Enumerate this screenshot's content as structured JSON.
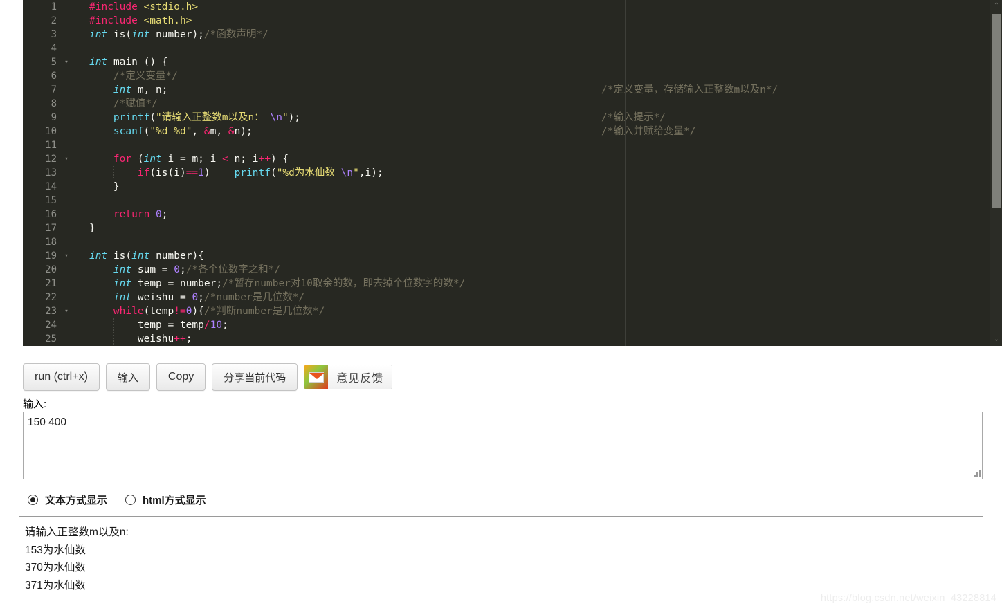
{
  "editor": {
    "lines": [
      {
        "n": "1",
        "fold": "",
        "html": "<span class='pp'>#include</span> <span class='inc'>&lt;stdio.h&gt;</span>",
        "comment": ""
      },
      {
        "n": "2",
        "fold": "",
        "html": "<span class='pp'>#include</span> <span class='inc'>&lt;math.h&gt;</span>",
        "comment": ""
      },
      {
        "n": "3",
        "fold": "",
        "html": "<span class='k'>int</span> <span class='pl'>is(</span><span class='k'>int</span> <span class='pl'>number);</span><span class='cm'>/*&#20989;&#25968;&#22768;&#26126;*/</span>",
        "comment": ""
      },
      {
        "n": "4",
        "fold": "",
        "html": "",
        "comment": ""
      },
      {
        "n": "5",
        "fold": "▾",
        "html": "<span class='k'>int</span> <span class='pl'>main () {</span>",
        "comment": ""
      },
      {
        "n": "6",
        "fold": "",
        "html": "    <span class='cm'>/*&#23450;&#20041;&#21464;&#37327;*/</span>",
        "comment": ""
      },
      {
        "n": "7",
        "fold": "",
        "html": "    <span class='k'>int</span> <span class='pl'>m, n;</span>",
        "comment": "/*定义变量，存储输入正整数m以及n*/"
      },
      {
        "n": "8",
        "fold": "",
        "html": "    <span class='cm'>/*&#36171;&#20540;*/</span>",
        "comment": ""
      },
      {
        "n": "9",
        "fold": "",
        "html": "    <span class='fn'>printf</span><span class='pl'>(</span><span class='str'>\"&#35831;&#36755;&#20837;&#27491;&#25972;&#25968;m&#20197;&#21450;n&#65306; </span><span class='esc'>\\n</span><span class='str'>\"</span><span class='pl'>);</span>",
        "comment": "/*输入提示*/"
      },
      {
        "n": "10",
        "fold": "",
        "html": "    <span class='fn'>scanf</span><span class='pl'>(</span><span class='str'>\"%d %d\"</span><span class='pl'>, </span><span class='op'>&amp;</span><span class='pl'>m, </span><span class='op'>&amp;</span><span class='pl'>n);</span>",
        "comment": "/*输入并赋给变量*/"
      },
      {
        "n": "11",
        "fold": "",
        "html": "",
        "comment": ""
      },
      {
        "n": "12",
        "fold": "▾",
        "html": "    <span class='kw'>for</span> <span class='pl'>(</span><span class='k'>int</span> <span class='pl'>i = m; i </span><span class='op'>&lt;</span><span class='pl'> n; i</span><span class='op'>++</span><span class='pl'>) {</span>",
        "comment": ""
      },
      {
        "n": "13",
        "fold": "",
        "html": "        <span class='kw'>if</span><span class='pl'>(is(i)</span><span class='op'>==</span><span class='num'>1</span><span class='pl'>)    </span><span class='fn'>printf</span><span class='pl'>(</span><span class='str'>\"%d&#20026;&#27700;&#20185;&#25968; </span><span class='esc'>\\n</span><span class='str'>\"</span><span class='pl'>,i);</span>",
        "comment": ""
      },
      {
        "n": "14",
        "fold": "",
        "html": "    <span class='pl'>}</span>",
        "comment": ""
      },
      {
        "n": "15",
        "fold": "",
        "html": "",
        "comment": ""
      },
      {
        "n": "16",
        "fold": "",
        "html": "    <span class='kw'>return</span> <span class='num'>0</span><span class='pl'>;</span>",
        "comment": ""
      },
      {
        "n": "17",
        "fold": "",
        "html": "<span class='pl'>}</span>",
        "comment": ""
      },
      {
        "n": "18",
        "fold": "",
        "html": "",
        "comment": ""
      },
      {
        "n": "19",
        "fold": "▾",
        "html": "<span class='k'>int</span> <span class='pl'>is(</span><span class='k'>int</span> <span class='pl'>number){</span>",
        "comment": ""
      },
      {
        "n": "20",
        "fold": "",
        "html": "    <span class='k'>int</span> <span class='pl'>sum = </span><span class='num'>0</span><span class='pl'>;</span><span class='cm'>/*&#21508;&#20010;&#20301;&#25968;&#23383;&#20043;&#21644;*/</span>",
        "comment": ""
      },
      {
        "n": "21",
        "fold": "",
        "html": "    <span class='k'>int</span> <span class='pl'>temp = number;</span><span class='cm'>/*&#26242;&#23384;number&#23545;10&#21462;&#20313;&#30340;&#25968;&#65292;&#21363;&#21435;&#25481;&#20010;&#20301;&#25968;&#23383;&#30340;&#25968;*/</span>",
        "comment": ""
      },
      {
        "n": "22",
        "fold": "",
        "html": "    <span class='k'>int</span> <span class='pl'>weishu = </span><span class='num'>0</span><span class='pl'>;</span><span class='cm'>/*number&#26159;&#20960;&#20301;&#25968;*/</span>",
        "comment": ""
      },
      {
        "n": "23",
        "fold": "▾",
        "html": "    <span class='kw'>while</span><span class='pl'>(temp</span><span class='op'>!=</span><span class='num'>0</span><span class='pl'>){</span><span class='cm'>/*&#21028;&#26029;number&#26159;&#20960;&#20301;&#25968;*/</span>",
        "comment": ""
      },
      {
        "n": "24",
        "fold": "",
        "html": "        <span class='pl'>temp = temp</span><span class='op'>/</span><span class='num'>10</span><span class='pl'>;</span>",
        "comment": ""
      },
      {
        "n": "25",
        "fold": "",
        "html": "        <span class='pl'>weishu</span><span class='op'>++</span><span class='pl'>;</span>",
        "comment": ""
      }
    ],
    "scrollbar": {
      "up_arrow": "⌃",
      "down_arrow": "⌄"
    }
  },
  "toolbar": {
    "run_label": "run (ctrl+x)",
    "input_label": "输入",
    "copy_label": "Copy",
    "share_label": "分享当前代码",
    "feedback_label": "意见反馈"
  },
  "input_section": {
    "label": "输入:",
    "value": "150 400",
    "placeholder": ""
  },
  "display_mode": {
    "options": [
      {
        "label": "文本方式显示",
        "selected": true
      },
      {
        "label": "html方式显示",
        "selected": false
      }
    ]
  },
  "output": {
    "lines": [
      "请输入正整数m以及n:",
      "153为水仙数",
      "370为水仙数",
      "371为水仙数"
    ]
  },
  "watermark": "https://blog.csdn.net/weixin_43228814",
  "colors": {
    "editor_bg": "#272822",
    "keyword": "#f92672",
    "type": "#66d9ef",
    "string": "#e6db74",
    "comment": "#75715e",
    "number": "#ae81ff",
    "text": "#f8f8f2"
  }
}
